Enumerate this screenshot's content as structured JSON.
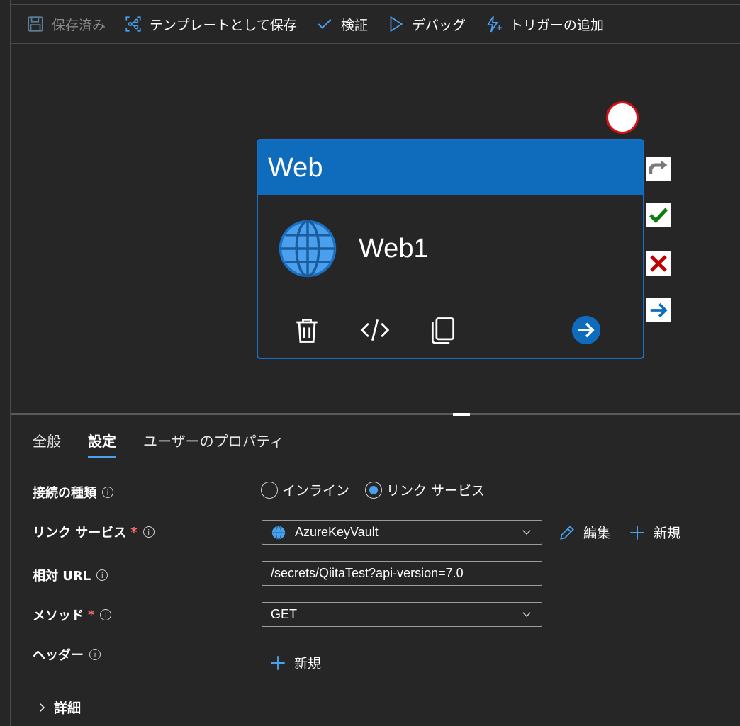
{
  "toolbar": {
    "saved": "保存済み",
    "save_as_template": "テンプレートとして保存",
    "validate": "検証",
    "debug": "デバッグ",
    "add_trigger": "トリガーの追加"
  },
  "activity": {
    "type": "Web",
    "name": "Web1"
  },
  "tabs": [
    "全般",
    "設定",
    "ユーザーのプロパティ"
  ],
  "form": {
    "connection_type_label": "接続の種類",
    "radio_inline": "インライン",
    "radio_linked": "リンク サービス",
    "linked_service_label": "リンク サービス",
    "linked_service_value": "AzureKeyVault",
    "edit_label": "編集",
    "new_label": "新規",
    "relative_url_label": "相対 URL",
    "relative_url_value": "/secrets/QiitaTest?api-version=7.0",
    "method_label": "メソッド",
    "method_value": "GET",
    "headers_label": "ヘッダー",
    "headers_new": "新規",
    "details_label": "詳細",
    "required_mark": "*",
    "info_mark": "i"
  },
  "colors": {
    "accent": "#0f6cbd",
    "failure": "#c00000",
    "success": "#107c10"
  }
}
